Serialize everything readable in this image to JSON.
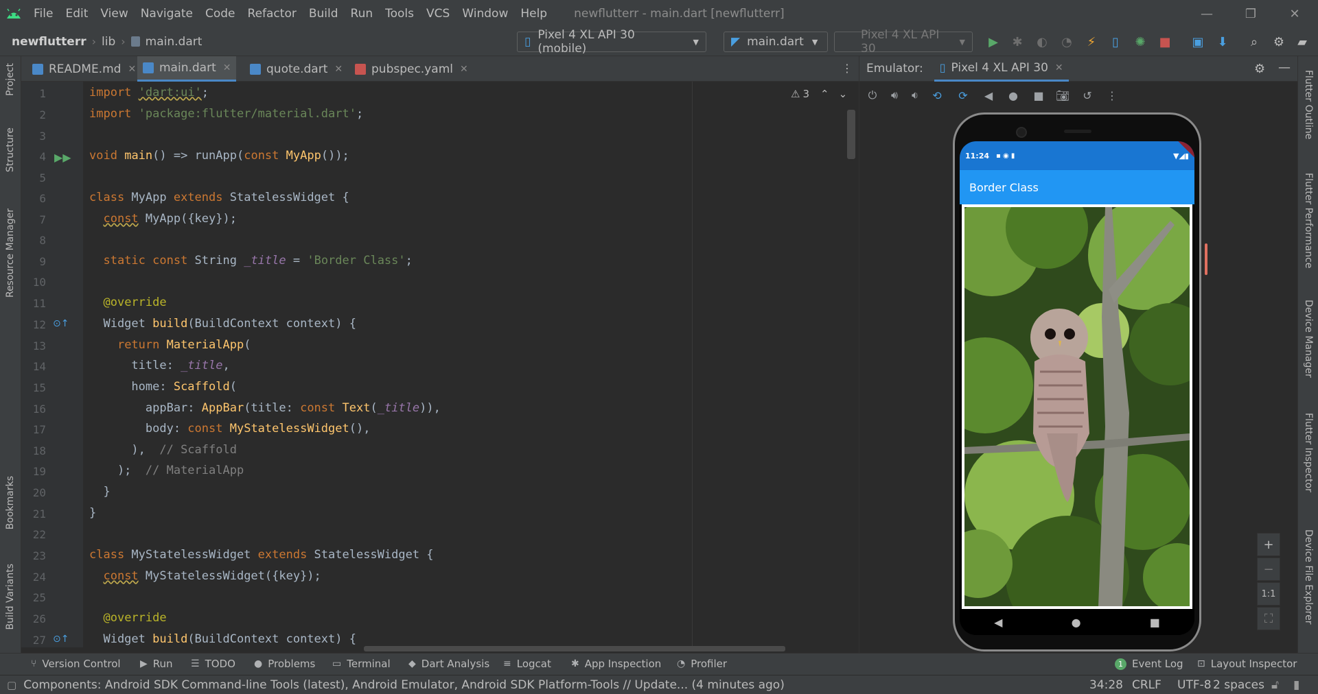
{
  "menubar": {
    "items": [
      "File",
      "Edit",
      "View",
      "Navigate",
      "Code",
      "Refactor",
      "Build",
      "Run",
      "Tools",
      "VCS",
      "Window",
      "Help"
    ],
    "window_title": "newflutterr - main.dart [newflutterr]"
  },
  "navbar": {
    "project": "newflutterr",
    "folder": "lib",
    "file": "main.dart",
    "device_combo": "Pixel 4 XL API 30 (mobile)",
    "run_config": "main.dart",
    "avd_combo": "Pixel 4 XL API 30"
  },
  "left_tools": [
    "Project",
    "Structure",
    "Resource Manager",
    "Bookmarks",
    "Build Variants"
  ],
  "right_tools": [
    "Flutter Outline",
    "Flutter Performance",
    "Device Manager",
    "Flutter Inspector",
    "Device File Explorer"
  ],
  "editor": {
    "tabs": [
      {
        "label": "README.md",
        "icon": "markdown-icon",
        "color": "#4a88c7"
      },
      {
        "label": "main.dart",
        "icon": "dart-icon",
        "color": "#4a88c7"
      },
      {
        "label": "quote.dart",
        "icon": "dart-icon",
        "color": "#4a88c7"
      },
      {
        "label": "pubspec.yaml",
        "icon": "yaml-icon",
        "color": "#c75450"
      }
    ],
    "warning_count": "3",
    "line_numbers": [
      "1",
      "2",
      "3",
      "4",
      "5",
      "6",
      "7",
      "8",
      "9",
      "10",
      "11",
      "12",
      "13",
      "14",
      "15",
      "16",
      "17",
      "18",
      "19",
      "20",
      "21",
      "22",
      "23",
      "24",
      "25",
      "26",
      "27"
    ]
  },
  "emulator": {
    "label": "Emulator:",
    "device_tab": "Pixel 4 XL API 30",
    "zoom_in": "+",
    "zoom_out": "−",
    "zoom_actual": "1:1",
    "phone": {
      "time": "11:24",
      "appbar_title": "Border Class",
      "photo_subject": "owl-on-branch"
    }
  },
  "toolwindows": [
    {
      "label": "Version Control",
      "icon": "branch-icon"
    },
    {
      "label": "Run",
      "icon": "play-icon"
    },
    {
      "label": "TODO",
      "icon": "list-icon"
    },
    {
      "label": "Problems",
      "icon": "info-icon"
    },
    {
      "label": "Terminal",
      "icon": "terminal-icon"
    },
    {
      "label": "Dart Analysis",
      "icon": "dart-analysis-icon"
    },
    {
      "label": "Logcat",
      "icon": "logcat-icon"
    },
    {
      "label": "App Inspection",
      "icon": "inspection-icon"
    },
    {
      "label": "Profiler",
      "icon": "profiler-icon"
    },
    {
      "label": "Event Log",
      "icon": "event-log-icon"
    },
    {
      "label": "Layout Inspector",
      "icon": "layout-inspector-icon"
    }
  ],
  "status": {
    "message": "Components: Android SDK Command-line Tools (latest), Android Emulator, Android SDK Platform-Tools // Update... (4 minutes ago)",
    "position": "34:28",
    "line_sep": "CRLF",
    "encoding": "UTF-8",
    "indent": "2 spaces",
    "event_count": "1"
  }
}
